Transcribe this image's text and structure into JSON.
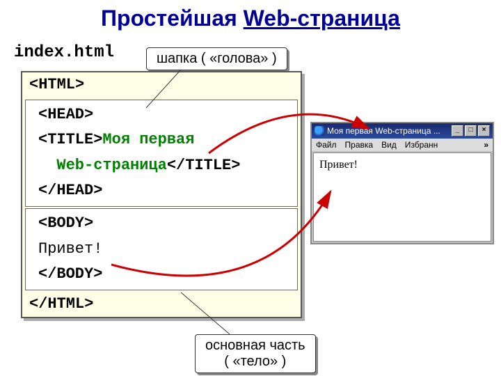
{
  "title_part1": "Простейшая ",
  "title_part2": "Web-страница",
  "filename": "index.html",
  "callout_top": "шапка ( «голова» )",
  "callout_bottom_line1": "основная часть",
  "callout_bottom_line2": "( «тело» )",
  "code": {
    "l1": "<HTML>",
    "l2": "<HEAD>",
    "l3a": "<TITLE>",
    "l3b": "Моя первая",
    "l4a": "  Web-страница",
    "l4b": "</TITLE>",
    "l5": "</HEAD>",
    "l6": "<BODY>",
    "l7": "Привет!",
    "l8": "</BODY>",
    "l9": "</HTML>"
  },
  "browser": {
    "titlebar": "Моя первая Web-страница ...",
    "menu": {
      "file": "Файл",
      "edit": "Правка",
      "view": "Вид",
      "fav": "Избранн",
      "chev": "»"
    },
    "body_text": "Привет!",
    "buttons": {
      "min": "_",
      "max": "□",
      "close": "×"
    }
  }
}
